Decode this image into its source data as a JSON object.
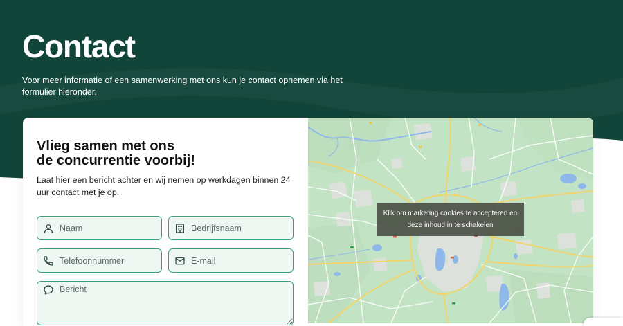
{
  "header": {
    "title": "Contact",
    "intro": "Voor meer informatie of een samenwerking met ons kun je contact opnemen via het formulier hieronder."
  },
  "form": {
    "heading": {
      "line1": "Vlieg samen met ons",
      "line2": "de concurrentie voorbij!"
    },
    "description": "Laat hier een bericht achter en wij nemen op werkdagen binnen 24 uur contact met je op.",
    "fields": {
      "name": {
        "placeholder": "Naam",
        "icon": "person-icon"
      },
      "company": {
        "placeholder": "Bedrijfsnaam",
        "icon": "building-icon"
      },
      "phone": {
        "placeholder": "Telefoonnummer",
        "icon": "phone-icon"
      },
      "email": {
        "placeholder": "E-mail",
        "icon": "envelope-icon"
      },
      "message": {
        "placeholder": "Bericht",
        "icon": "chat-bubble-icon"
      }
    }
  },
  "map": {
    "cookie_notice": "Klik om marketing cookies te accepteren en deze inhoud in te schakelen"
  },
  "colors": {
    "header_background": "#124539",
    "field_border": "#34a07a",
    "field_background": "#eef7f2",
    "map_land": "#c3e4c4",
    "map_water": "#8fb8ea",
    "map_highway": "#f3d46b"
  }
}
